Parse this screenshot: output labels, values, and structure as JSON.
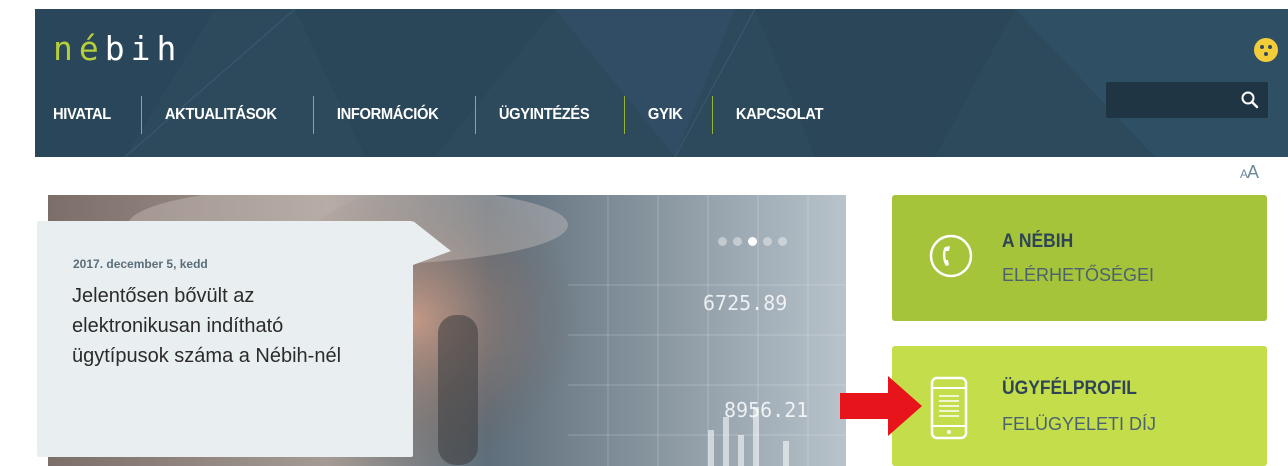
{
  "header": {
    "logo": {
      "letters": [
        "n",
        "é",
        "b",
        "i",
        "h"
      ]
    },
    "nav": [
      {
        "label": "HIVATAL"
      },
      {
        "label": "AKTUALITÁSOK"
      },
      {
        "label": "INFORMÁCIÓK"
      },
      {
        "label": "ÜGYINTÉZÉS"
      },
      {
        "label": "GYIK"
      },
      {
        "label": "KAPCSOLAT"
      }
    ],
    "search": {
      "placeholder": ""
    },
    "accent_color": "#9dbe33",
    "background_color": "#2d4a5c"
  },
  "font_size_toggle": {
    "small": "A",
    "large": "A"
  },
  "slider": {
    "dots": 5,
    "active_dot": 3,
    "screen_numbers": [
      "6725.89",
      "8956.21"
    ],
    "news": {
      "date": "2017. december 5, kedd",
      "title": "Jelentősen bővült az elektronikusan indítható ügytípusok száma a Nébih-nél"
    }
  },
  "tiles": [
    {
      "title": "A NÉBIH",
      "subtitle": "ELÉRHETŐSÉGEI",
      "icon": "phone-icon",
      "color": "#a5c43a"
    },
    {
      "title": "ÜGYFÉLPROFIL",
      "subtitle": "FELÜGYELETI DÍJ",
      "icon": "mobile-document-icon",
      "color": "#c4dd4b"
    }
  ],
  "annotation": {
    "icon": "red-arrow-icon",
    "color": "#e8141b"
  }
}
